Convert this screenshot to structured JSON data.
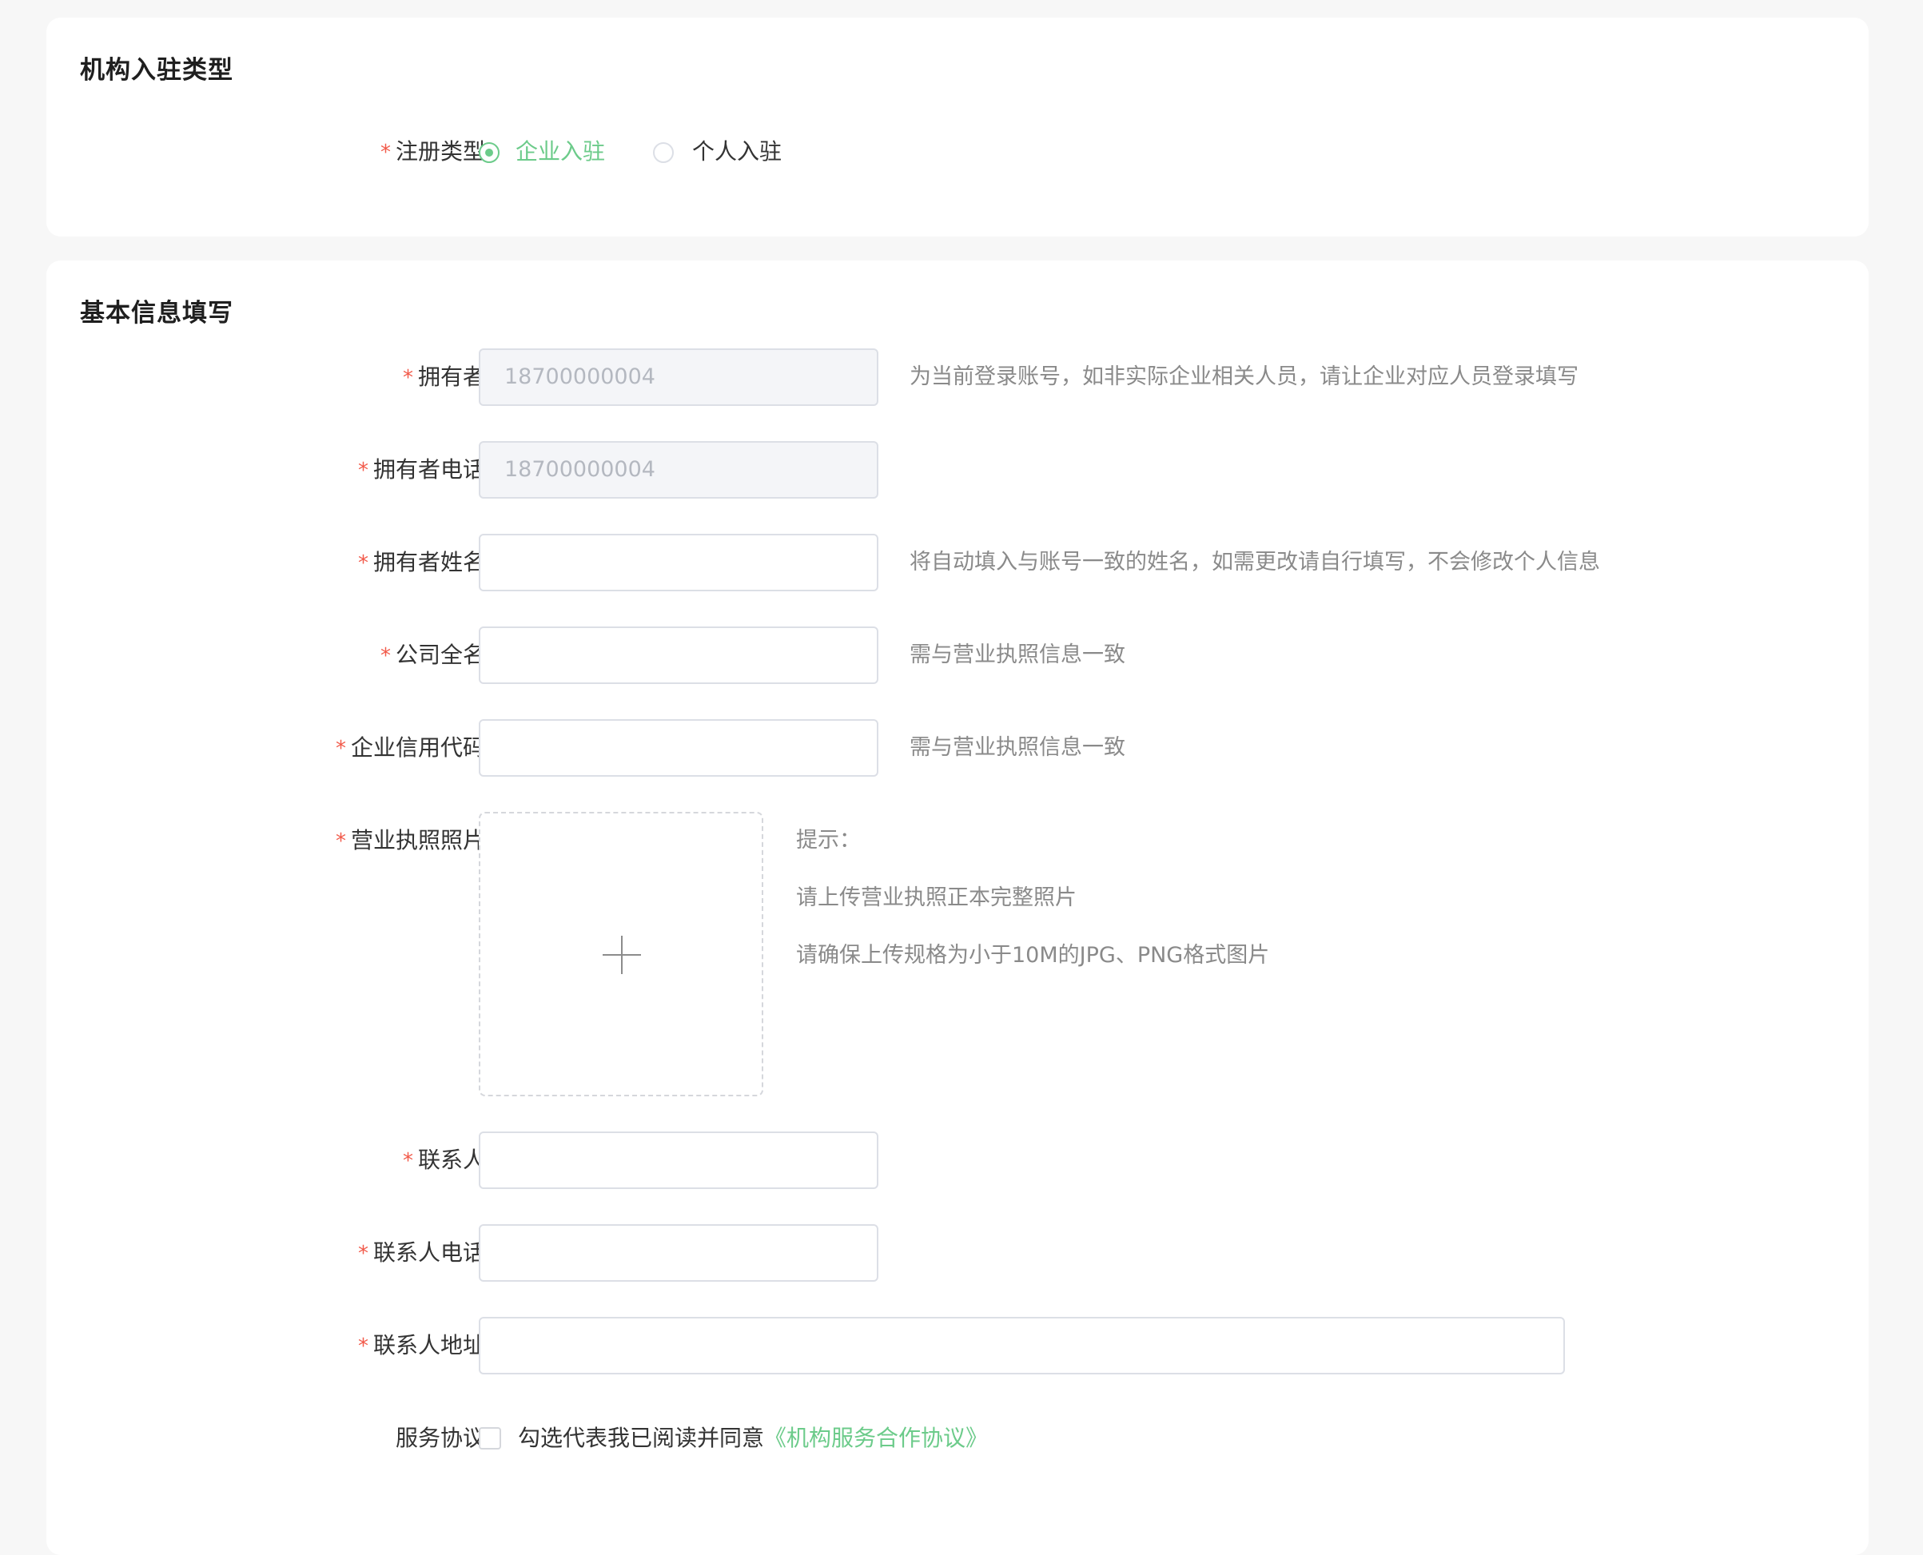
{
  "section_type": {
    "title": "机构入驻类型",
    "register_type_label": "注册类型",
    "options": [
      {
        "label": "企业入驻",
        "checked": true
      },
      {
        "label": "个人入驻",
        "checked": false
      }
    ]
  },
  "section_basic": {
    "title": "基本信息填写",
    "owner": {
      "label": "拥有者",
      "value": "18700000004",
      "hint": "为当前登录账号，如非实际企业相关人员，请让企业对应人员登录填写"
    },
    "owner_phone": {
      "label": "拥有者电话",
      "value": "18700000004"
    },
    "owner_name": {
      "label": "拥有者姓名",
      "value": "",
      "hint": "将自动填入与账号一致的姓名，如需更改请自行填写，不会修改个人信息"
    },
    "company_name": {
      "label": "公司全名",
      "value": "",
      "hint": "需与营业执照信息一致"
    },
    "credit_code": {
      "label": "企业信用代码",
      "value": "",
      "hint": "需与营业执照信息一致"
    },
    "license_photo": {
      "label": "营业执照照片",
      "tips": [
        "提示：",
        "请上传营业执照正本完整照片",
        "请确保上传规格为小于10M的JPG、PNG格式图片"
      ]
    },
    "contact": {
      "label": "联系人",
      "value": ""
    },
    "contact_phone": {
      "label": "联系人电话",
      "value": ""
    },
    "contact_address": {
      "label": "联系人地址",
      "value": ""
    },
    "agreement": {
      "label": "服务协议",
      "text": "勾选代表我已阅读并同意",
      "link": "《机构服务合作协议》",
      "checked": false
    }
  },
  "colors": {
    "accent": "#6ccb8a",
    "required": "#f25a4a",
    "hint": "#8a8a8a"
  }
}
